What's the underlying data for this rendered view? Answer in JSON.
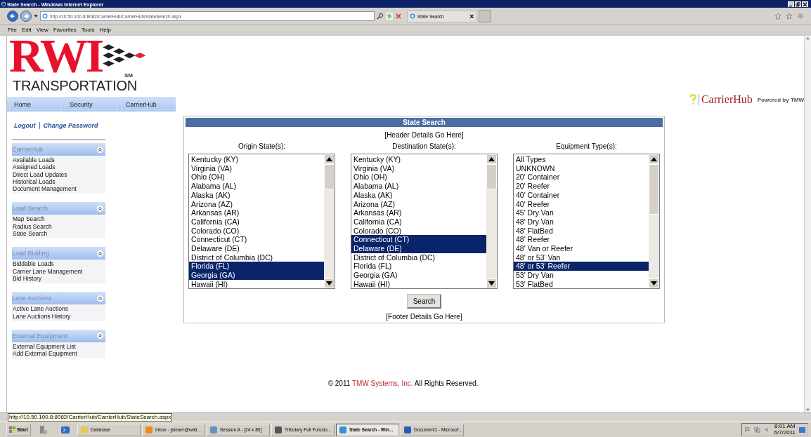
{
  "window": {
    "title": "State Search - Windows Internet Explorer"
  },
  "browser": {
    "address": "http://10.50.100.8:8082/CarrierHub/CarrierHub/StateSearch.aspx",
    "tab": "State Search",
    "tab_close": "×",
    "menu": [
      "File",
      "Edit",
      "View",
      "Favorites",
      "Tools",
      "Help"
    ]
  },
  "logo": {
    "name": "RWI",
    "mark": "SM",
    "subtitle": "TRANSPORTATION"
  },
  "brand": {
    "name": "CarrierHub",
    "powered": "Powered by TMW"
  },
  "nav": [
    {
      "label": "Home"
    },
    {
      "label": "Security"
    },
    {
      "label": "CarrierHub"
    }
  ],
  "account_links": [
    "Logout",
    "Change Password"
  ],
  "sidebar": [
    {
      "title": "CarrierHub",
      "expanded": true,
      "items": [
        "Available Loads",
        "Assigned Loads",
        "Direct Load Updates",
        "Historical Loads",
        "Document Management"
      ]
    },
    {
      "title": "Load Search",
      "expanded": true,
      "items": [
        "Map Search",
        "Radius Search",
        "State Search"
      ]
    },
    {
      "title": "Load Bidding",
      "expanded": true,
      "items": [
        "Biddable Loads",
        "Carrier Lane Management",
        "Bid History"
      ]
    },
    {
      "title": "Lane Auctions",
      "expanded": true,
      "items": [
        "Active Lane Auctions",
        "Lane Auctions History"
      ]
    },
    {
      "title": "External Equipment",
      "expanded": true,
      "items": [
        "External Equipment List",
        "Add External Equipment"
      ]
    }
  ],
  "panel": {
    "title": "State Search",
    "header": "[Header Details Go Here]",
    "footer": "[Footer Details Go Here]",
    "button": "Search",
    "lists": [
      {
        "label": "Origin State(s):",
        "options": [
          {
            "label": "Kentucky (KY)",
            "selected": false
          },
          {
            "label": "Virginia (VA)",
            "selected": false
          },
          {
            "label": "Ohio (OH)",
            "selected": false
          },
          {
            "label": "Alabama (AL)",
            "selected": false
          },
          {
            "label": "Alaska (AK)",
            "selected": false
          },
          {
            "label": "Arizona (AZ)",
            "selected": false
          },
          {
            "label": "Arkansas (AR)",
            "selected": false
          },
          {
            "label": "California (CA)",
            "selected": false
          },
          {
            "label": "Colorado (CO)",
            "selected": false
          },
          {
            "label": "Connecticut (CT)",
            "selected": false
          },
          {
            "label": "Delaware (DE)",
            "selected": false
          },
          {
            "label": "District of Columbia (DC)",
            "selected": false
          },
          {
            "label": "Florida (FL)",
            "selected": true
          },
          {
            "label": "Georgia (GA)",
            "selected": true
          },
          {
            "label": "Hawaii (HI)",
            "selected": false
          }
        ]
      },
      {
        "label": "Destination State(s):",
        "options": [
          {
            "label": "Kentucky (KY)",
            "selected": false
          },
          {
            "label": "Virginia (VA)",
            "selected": false
          },
          {
            "label": "Ohio (OH)",
            "selected": false
          },
          {
            "label": "Alabama (AL)",
            "selected": false
          },
          {
            "label": "Alaska (AK)",
            "selected": false
          },
          {
            "label": "Arizona (AZ)",
            "selected": false
          },
          {
            "label": "Arkansas (AR)",
            "selected": false
          },
          {
            "label": "California (CA)",
            "selected": false
          },
          {
            "label": "Colorado (CO)",
            "selected": false
          },
          {
            "label": "Connecticut (CT)",
            "selected": true
          },
          {
            "label": "Delaware (DE)",
            "selected": true
          },
          {
            "label": "District of Columbia (DC)",
            "selected": false
          },
          {
            "label": "Florida (FL)",
            "selected": false
          },
          {
            "label": "Georgia (GA)",
            "selected": false
          },
          {
            "label": "Hawaii (HI)",
            "selected": false
          }
        ]
      },
      {
        "label": "Equipment Type(s):",
        "options": [
          {
            "label": "All Types",
            "selected": false
          },
          {
            "label": "UNKNOWN",
            "selected": false
          },
          {
            "label": "20' Container",
            "selected": false
          },
          {
            "label": "20' Reefer",
            "selected": false
          },
          {
            "label": "40' Container",
            "selected": false
          },
          {
            "label": "40' Reefer",
            "selected": false
          },
          {
            "label": "45' Dry Van",
            "selected": false
          },
          {
            "label": "48' Dry Van",
            "selected": false
          },
          {
            "label": "48' FlatBed",
            "selected": false
          },
          {
            "label": "48' Reefer",
            "selected": false
          },
          {
            "label": "48' Van or Reefer",
            "selected": false
          },
          {
            "label": "48' or 53' Van",
            "selected": false
          },
          {
            "label": "48' or 53' Reefer",
            "selected": true
          },
          {
            "label": "53' Dry Van",
            "selected": false
          },
          {
            "label": "53' FlatBed",
            "selected": false
          }
        ]
      }
    ]
  },
  "copyright": {
    "prefix": "© 2011",
    "company": "TMW Systems, Inc.",
    "suffix": "All Rights Reserved."
  },
  "status_bar": {
    "url": "http://10.50.100.8:8082/CarrierHub/CarrierHub/StateSearch.aspx"
  },
  "taskbar": {
    "start": "Start",
    "items": [
      {
        "label": "Database",
        "selected": false
      },
      {
        "label": "Inbox - jsteuer@rwitr...",
        "selected": false
      },
      {
        "label": "Session A - [24 x 80]",
        "selected": false
      },
      {
        "label": "Tributary Full Functio...",
        "selected": false
      },
      {
        "label": "State Search - Win...",
        "selected": true
      },
      {
        "label": "Document1 - Microsof...",
        "selected": false
      }
    ],
    "time": "8:01 AM",
    "date": "6/7/2011"
  }
}
